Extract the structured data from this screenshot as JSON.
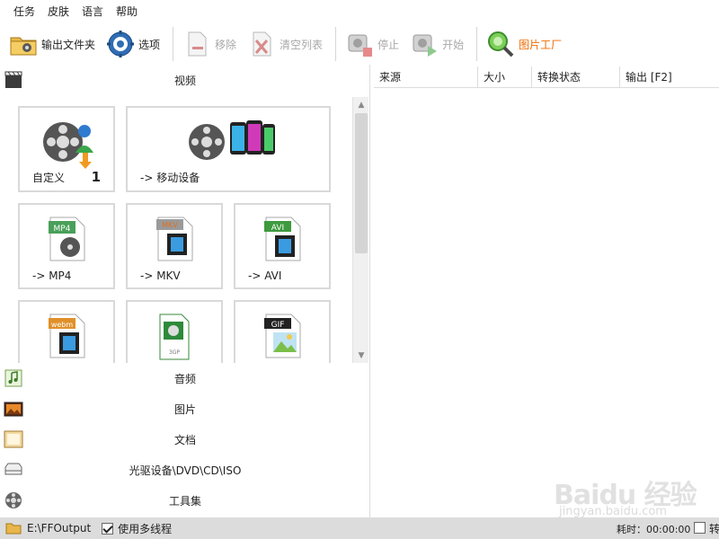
{
  "menu": {
    "items": [
      "任务",
      "皮肤",
      "语言",
      "帮助"
    ]
  },
  "toolbar": {
    "output_folder": "输出文件夹",
    "options": "选项",
    "remove": "移除",
    "clear_list": "清空列表",
    "stop": "停止",
    "start": "开始",
    "picture_factory": "图片工厂"
  },
  "left": {
    "categories": {
      "video": "视频",
      "audio": "音频",
      "picture": "图片",
      "document": "文档",
      "optical": "光驱设备\\DVD\\CD\\ISO",
      "tools": "工具集"
    },
    "tiles": {
      "custom": {
        "label": "自定义",
        "badge": "1"
      },
      "mobile": {
        "label": "-> 移动设备"
      },
      "mp4": {
        "label": "-> MP4",
        "tag": "MP4"
      },
      "mkv": {
        "label": "-> MKV",
        "tag": "MKV"
      },
      "avi": {
        "label": "-> AVI",
        "tag": "AVI"
      },
      "webm": {
        "tag": "webm"
      },
      "3gp": {
        "tag": "3GP"
      },
      "gif": {
        "tag": "GIF"
      }
    }
  },
  "table": {
    "columns": [
      "来源",
      "大小",
      "转换状态",
      "输出 [F2]"
    ]
  },
  "status": {
    "path": "E:\\FFOutput",
    "multithread_label": "使用多线程",
    "multithread_checked": true,
    "elapsed": "耗时：00:00:00",
    "trailing": "转"
  },
  "watermark": {
    "brand": "Baidu 经验",
    "url": "jingyan.baidu.com"
  },
  "colors": {
    "accent": "#ef6b00",
    "statusbar": "#dcdcdc",
    "tile_border": "#d9d9d9"
  }
}
